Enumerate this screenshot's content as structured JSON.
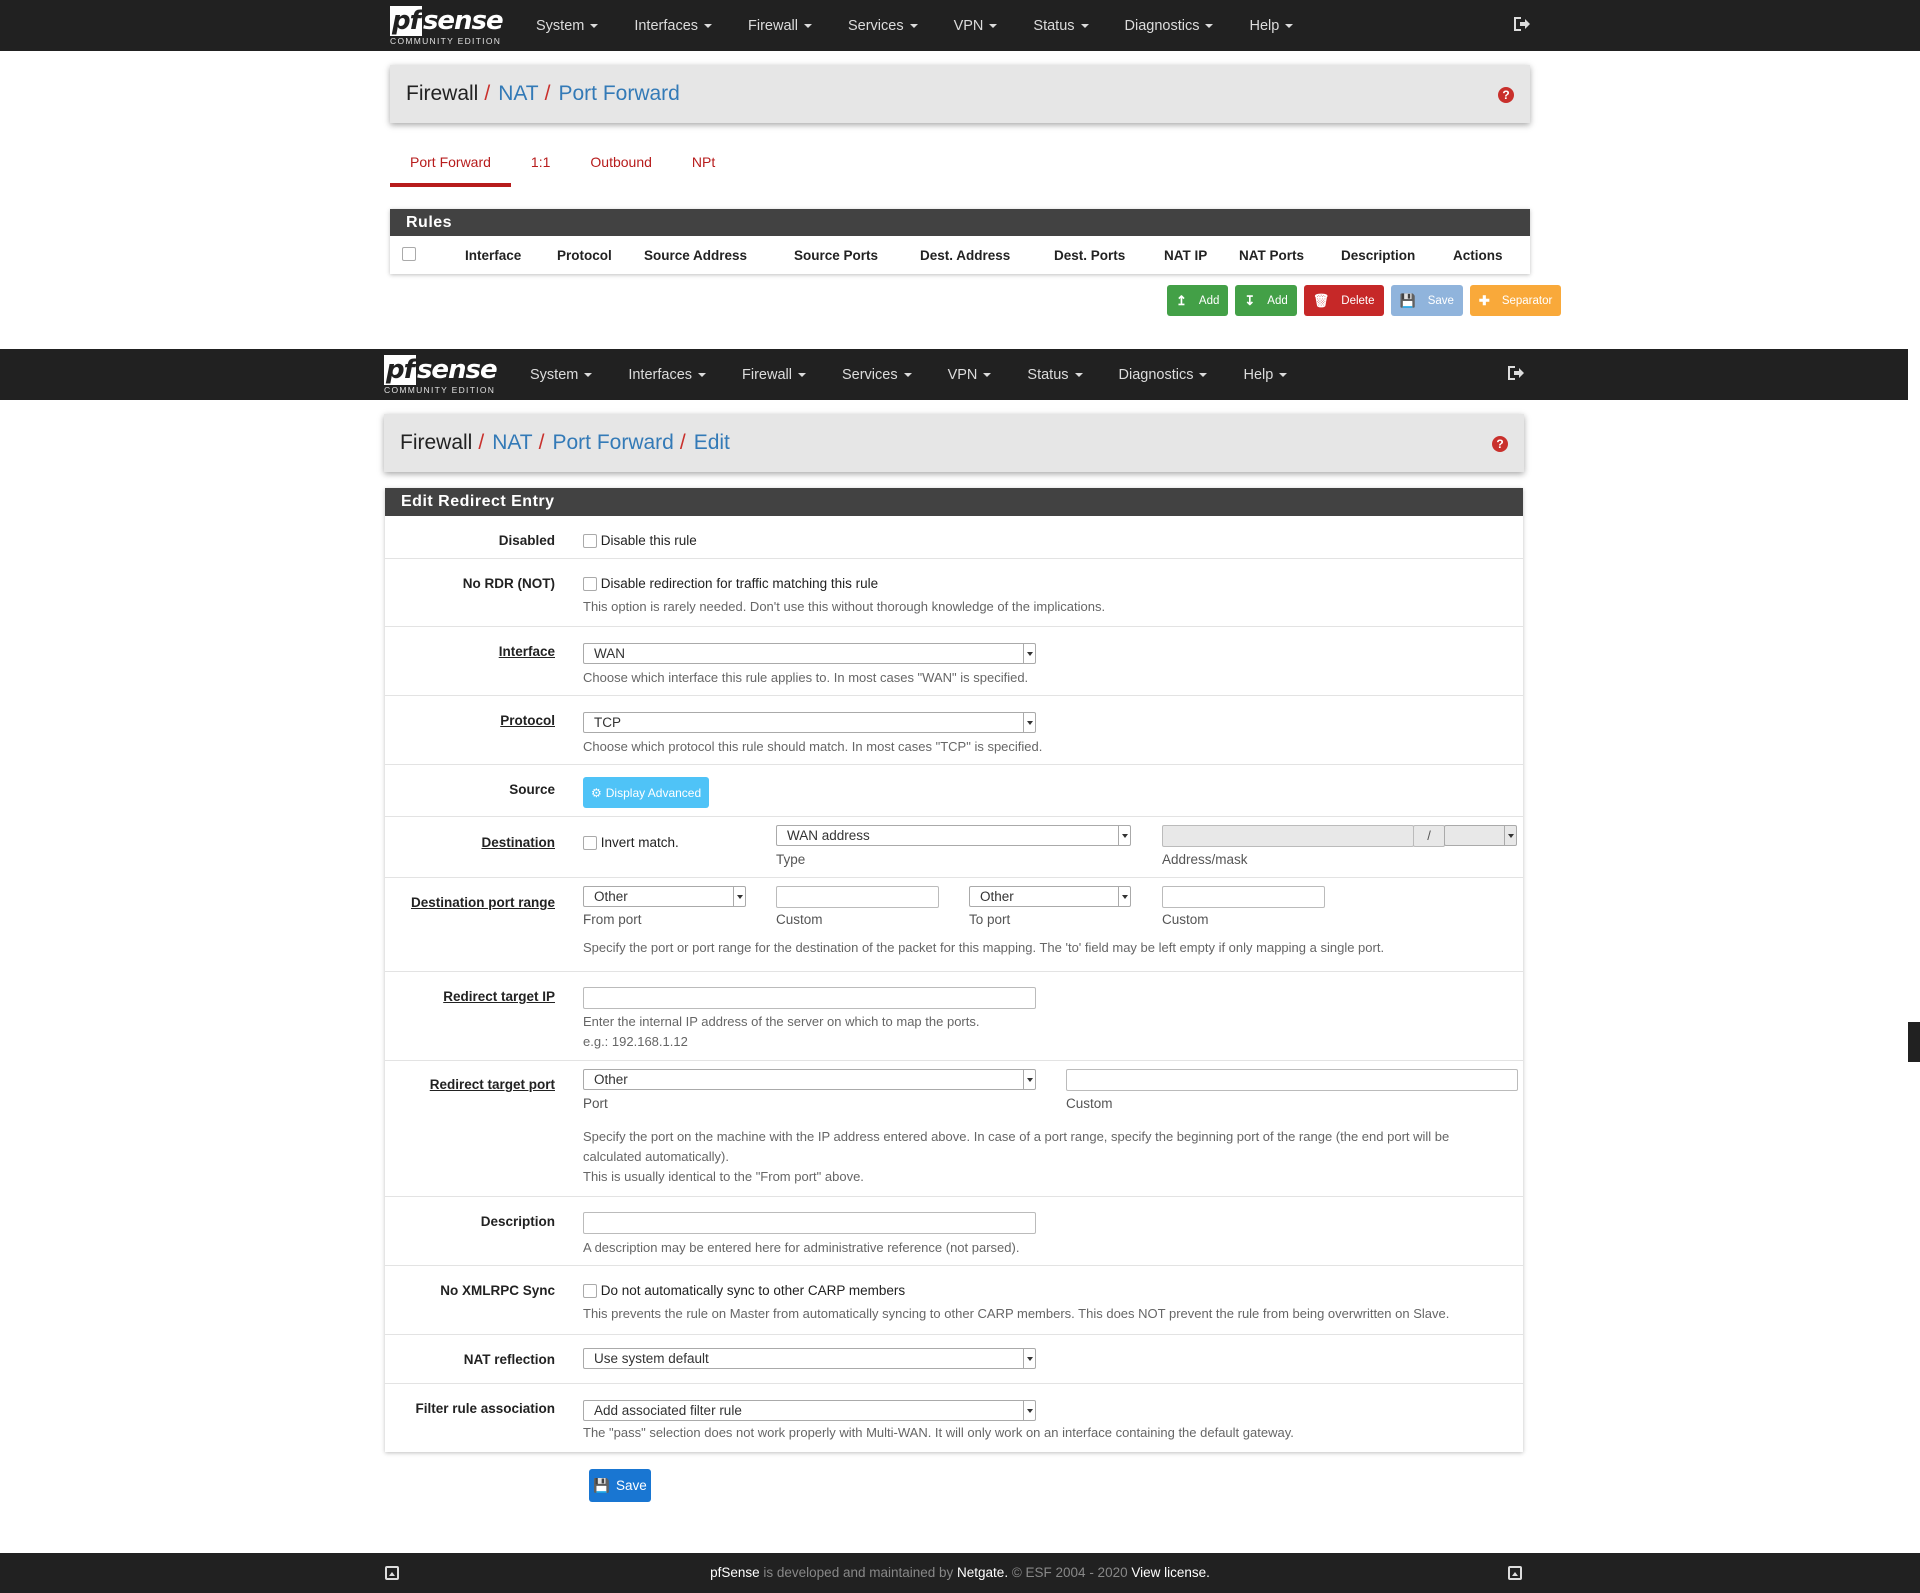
{
  "nav": {
    "logo_pf": "pf",
    "logo_sense": "sense",
    "logo_edition": "COMMUNITY EDITION",
    "items": [
      "System",
      "Interfaces",
      "Firewall",
      "Services",
      "VPN",
      "Status",
      "Diagnostics",
      "Help"
    ]
  },
  "top_page": {
    "breadcrumb": [
      "Firewall",
      "NAT",
      "Port Forward"
    ],
    "tabs": [
      "Port Forward",
      "1:1",
      "Outbound",
      "NPt"
    ],
    "rules": {
      "title": "Rules",
      "columns": [
        "Interface",
        "Protocol",
        "Source Address",
        "Source Ports",
        "Dest. Address",
        "Dest. Ports",
        "NAT IP",
        "NAT Ports",
        "Description",
        "Actions"
      ]
    },
    "buttons": {
      "add_top": "Add",
      "add_bottom": "Add",
      "delete": "Delete",
      "save": "Save",
      "separator": "Separator"
    }
  },
  "edit_page": {
    "breadcrumb": [
      "Firewall",
      "NAT",
      "Port Forward",
      "Edit"
    ],
    "panel_title": "Edit Redirect Entry",
    "disabled": {
      "label": "Disabled",
      "checkbox": "Disable this rule"
    },
    "nordr": {
      "label": "No RDR (NOT)",
      "checkbox": "Disable redirection for traffic matching this rule",
      "hint": "This option is rarely needed. Don't use this without thorough knowledge of the implications."
    },
    "interface": {
      "label": "Interface",
      "value": "WAN",
      "hint": "Choose which interface this rule applies to. In most cases \"WAN\" is specified."
    },
    "protocol": {
      "label": "Protocol",
      "value": "TCP",
      "hint": "Choose which protocol this rule should match. In most cases \"TCP\" is specified."
    },
    "source": {
      "label": "Source",
      "button": "Display Advanced"
    },
    "destination": {
      "label": "Destination",
      "invert": "Invert match.",
      "type_value": "WAN address",
      "type_label": "Type",
      "mask_sep": "/",
      "address_label": "Address/mask"
    },
    "dest_port_range": {
      "label": "Destination port range",
      "from_value": "Other",
      "from_label": "From port",
      "custom1_label": "Custom",
      "to_value": "Other",
      "to_label": "To port",
      "custom2_label": "Custom",
      "hint": "Specify the port or port range for the destination of the packet for this mapping. The 'to' field may be left empty if only mapping a single port."
    },
    "redirect_ip": {
      "label": "Redirect target IP",
      "hint1": "Enter the internal IP address of the server on which to map the ports.",
      "hint2": "e.g.: 192.168.1.12"
    },
    "redirect_port": {
      "label": "Redirect target port",
      "value": "Other",
      "port_label": "Port",
      "custom_label": "Custom",
      "hint1": "Specify the port on the machine with the IP address entered above. In case of a port range, specify the beginning port of the range (the end port will be",
      "hint2": "calculated automatically).",
      "hint3": "This is usually identical to the \"From port\" above."
    },
    "description": {
      "label": "Description",
      "hint": "A description may be entered here for administrative reference (not parsed)."
    },
    "xmlrpc": {
      "label": "No XMLRPC Sync",
      "checkbox": "Do not automatically sync to other CARP members",
      "hint": "This prevents the rule on Master from automatically syncing to other CARP members. This does NOT prevent the rule from being overwritten on Slave."
    },
    "nat_reflection": {
      "label": "NAT reflection",
      "value": "Use system default"
    },
    "filter_rule": {
      "label": "Filter rule association",
      "value": "Add associated filter rule",
      "hint": "The \"pass\" selection does not work properly with Multi-WAN. It will only work on an interface containing the default gateway."
    },
    "save": "Save"
  },
  "footer": {
    "brand": "pfSense",
    "text1": " is developed and maintained by ",
    "company": "Netgate.",
    "text2": " © ESF 2004 - 2020 ",
    "license": "View license."
  },
  "colors": {
    "navbar": "#212121",
    "accent_red": "#c9302c",
    "link_blue": "#337ab7",
    "green": "#43a047",
    "orange": "#f9a93a"
  }
}
